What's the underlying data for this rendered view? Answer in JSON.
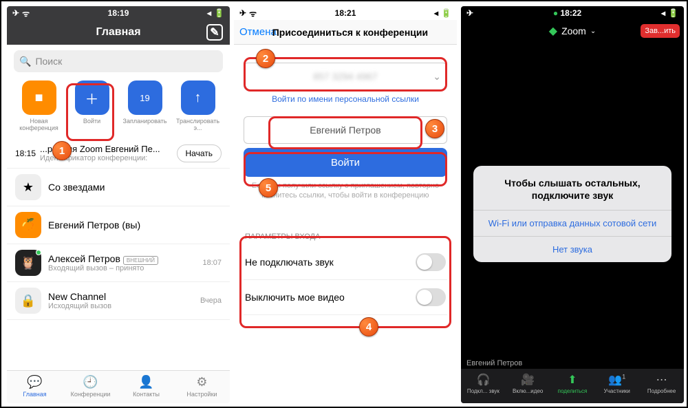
{
  "p1": {
    "status": {
      "time": "18:19",
      "l1": "✈︎",
      "l2": "ᯤ",
      "r1": "◂",
      "r2": "🔋"
    },
    "title": "Главная",
    "search_placeholder": "Поиск",
    "quick": [
      {
        "label": "Новая конференция",
        "glyph": "■"
      },
      {
        "label": "Войти",
        "glyph": "＋"
      },
      {
        "label": "Запланировать",
        "glyph": "19"
      },
      {
        "label": "Транслировать э...",
        "glyph": "↑"
      }
    ],
    "meeting": {
      "time": "18:15",
      "title": "...ренция Zoom Евгений Пе...",
      "sub": "Идентификатор конференции:",
      "start": "Начать"
    },
    "rows": [
      {
        "icon": "★",
        "bg": "#eee",
        "title": "Со звездами"
      },
      {
        "icon": "🍊",
        "bg": "#ff8c00",
        "title": "Евгений Петров (вы)"
      },
      {
        "icon": "🦉",
        "bg": "#222",
        "title": "Алексей Петров",
        "badge": "ВНЕШНИЙ",
        "sub": "Входящий вызов – принято",
        "time": "18:07"
      },
      {
        "icon": "🔒",
        "bg": "#eee",
        "title": "New Channel",
        "sub": "Исходящий вызов",
        "time": "Вчера"
      }
    ],
    "tabs": [
      {
        "icon": "💬",
        "label": "Главная"
      },
      {
        "icon": "🕘",
        "label": "Конференции"
      },
      {
        "icon": "👤",
        "label": "Контакты"
      },
      {
        "icon": "⚙",
        "label": "Настройки"
      }
    ]
  },
  "p2": {
    "status": {
      "time": "18:21",
      "l1": "✈︎",
      "l2": "ᯤ",
      "r1": "◂",
      "r2": "🔋"
    },
    "cancel": "Отмена",
    "title": "Присоединиться к конференции",
    "meeting_id": "857 3294 4967",
    "link": "Войти по имени персональной ссылки",
    "name": "Евгений Петров",
    "join": "Войти",
    "hint": "Если вы получили ссылку с приглашением, повторно коснитесь ссылки, чтобы войти в конференцию",
    "section": "ПАРАМЕТРЫ ВХОДА",
    "opt1": "Не подключать звук",
    "opt2": "Выключить мое видео"
  },
  "p3": {
    "status": {
      "time": "18:22",
      "l1": "✈︎",
      "l2": "",
      "r1": "◂",
      "r2": "🔋"
    },
    "app": "Zoom",
    "end": "Зав...ить",
    "dialog": {
      "msg": "Чтобы слышать остальных, подключите звук",
      "opt1": "Wi-Fi или отправка данных сотовой сети",
      "opt2": "Нет звука"
    },
    "participant": "Евгений Петров",
    "bar": [
      {
        "icon": "🎧",
        "label": "Подкл... звук"
      },
      {
        "icon": "🎥",
        "label": "Вклю...идео"
      },
      {
        "icon": "⬆",
        "label": "поделиться"
      },
      {
        "icon": "👥",
        "label": "Участники",
        "count": "1"
      },
      {
        "icon": "⋯",
        "label": "Подробнее"
      }
    ]
  }
}
